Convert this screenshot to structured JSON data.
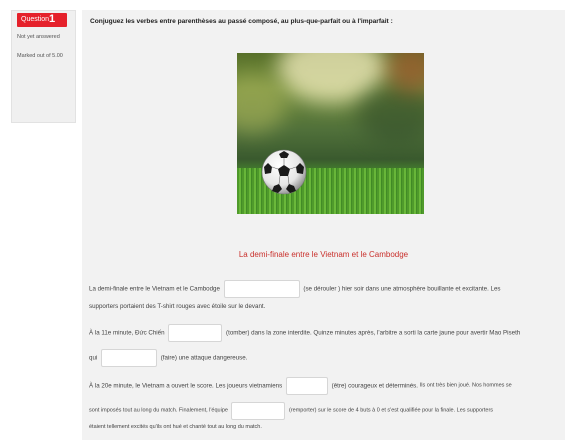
{
  "question": {
    "label": "Question",
    "number": "1",
    "status": "Not yet answered",
    "marks": "Marked out of 5.00"
  },
  "instruction": "Conjuguez les verbes entre parenthèses au passé composé, au plus-que-parfait ou à l'imparfait :",
  "image": {
    "alt": "Ballon de football sur l'herbe"
  },
  "subtitle": "La demi-finale entre le Vietnam et le Cambodge",
  "text": {
    "p1_a": "La demi-finale entre le Vietnam et le Cambodge",
    "p1_b": "(se dérouler ) hier soir dans une atmosphère bouillante et excitante. Les",
    "p2": "supporters portaient des T-shirt rouges avec étoile sur le devant.",
    "p3_a": "À la 11e minute, Đức Chiến",
    "p3_b": "(tomber) dans la zone interdite. Quinze minutes après, l'arbitre a sorti la carte jaune pour avertir Mao Piseth",
    "p4_a": "qui",
    "p4_b": "(faire) une attaque dangereuse.",
    "p5_a": "À la 20e minute, le Vietnam a ouvert le score. Les joueurs vietnamiens",
    "p5_b": "(être) courageux et déterminés.",
    "p5_c": "Ils ont très bien joué. Nos hommes se",
    "p6_a": "sont imposés tout au long du match. Finalement, l'équipe",
    "p6_b": "(remporter) sur le score de 4 buts à 0 et s'est qualifiée  pour la finale.  Les supporters",
    "p7": "étaient tellement excités qu'ils ont hué et chanté tout au long du match."
  },
  "inputs": {
    "blank1": "",
    "blank2": "",
    "blank3": "",
    "blank4": "",
    "blank5": ""
  },
  "colors": {
    "accent": "#e5212b",
    "subtitle": "#c9302c",
    "panel": "#f2f2f2"
  }
}
